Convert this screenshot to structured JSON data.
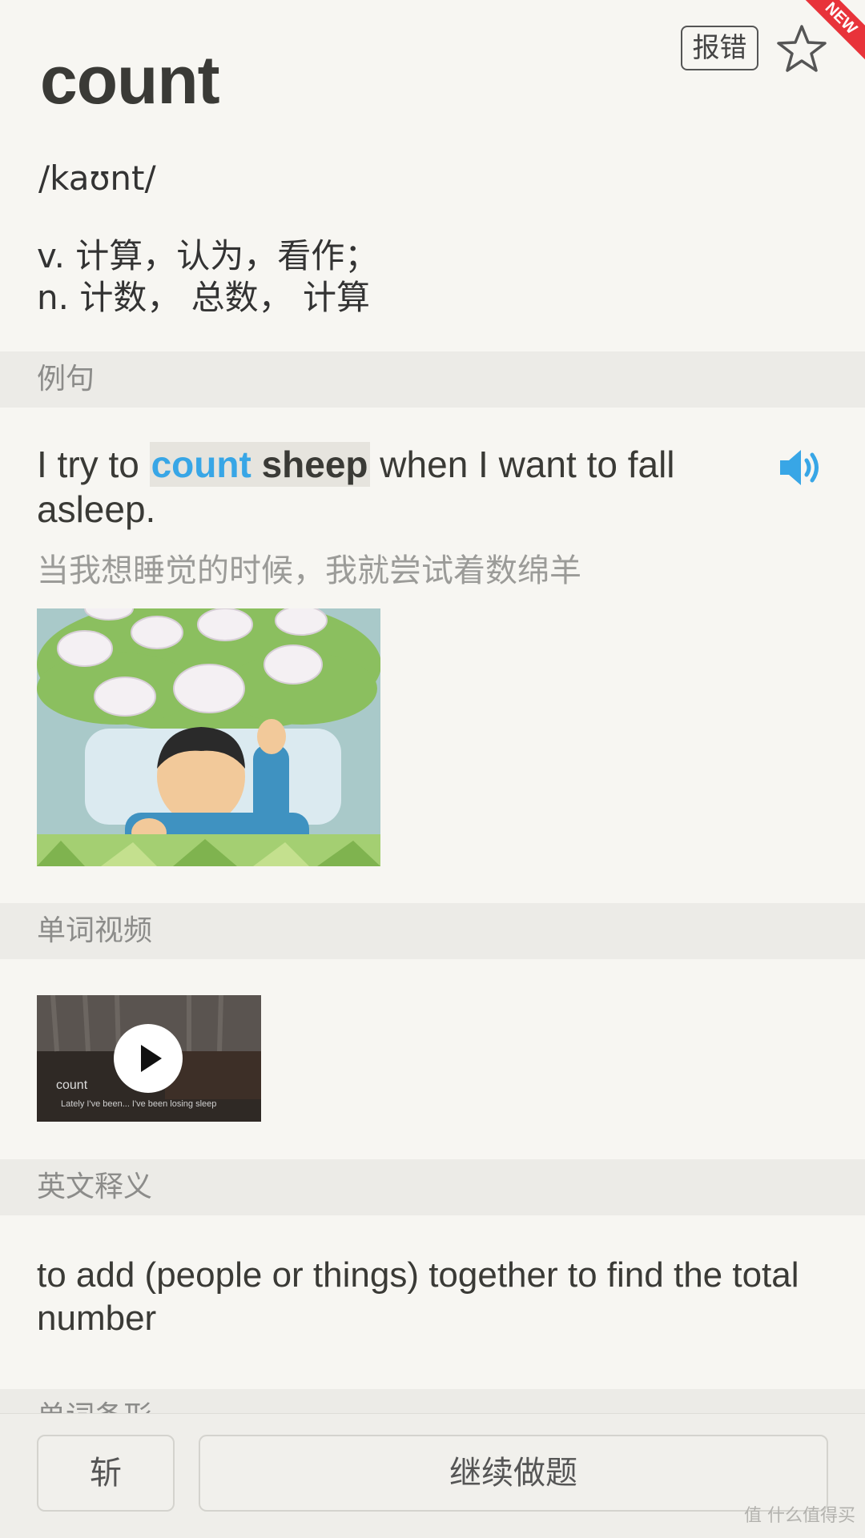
{
  "header": {
    "word": "count",
    "report_label": "报错",
    "ribbon_label": "NEW"
  },
  "phonetic": "/kaʊnt/",
  "definitions": [
    "v. 计算，认为，看作；",
    "n. 计数， 总数， 计算"
  ],
  "sections": {
    "examples": "例句",
    "video": "单词视频",
    "english_def": "英文释义",
    "partial_next": "单词备形"
  },
  "example": {
    "pre": "I try to ",
    "highlight_word": "count",
    "highlight_rest": " sheep",
    "post": " when I want to fall asleep.",
    "translation": "当我想睡觉的时候，我就尝试着数绵羊"
  },
  "video": {
    "word_caption": "count",
    "subtitle": "Lately I've been... I've been losing sleep"
  },
  "english_definition": "to add (people or things) together to find the total number",
  "bottom": {
    "kill_label": "斩",
    "continue_label": "继续做题"
  },
  "watermark": "值 什么值得买",
  "colors": {
    "accent_blue": "#38a6e6",
    "background": "#f7f6f2",
    "section_bar": "#ecebe7",
    "ribbon_red": "#e8333a"
  },
  "icons": {
    "star": "star-outline-icon",
    "speaker": "speaker-icon",
    "play": "play-icon"
  }
}
